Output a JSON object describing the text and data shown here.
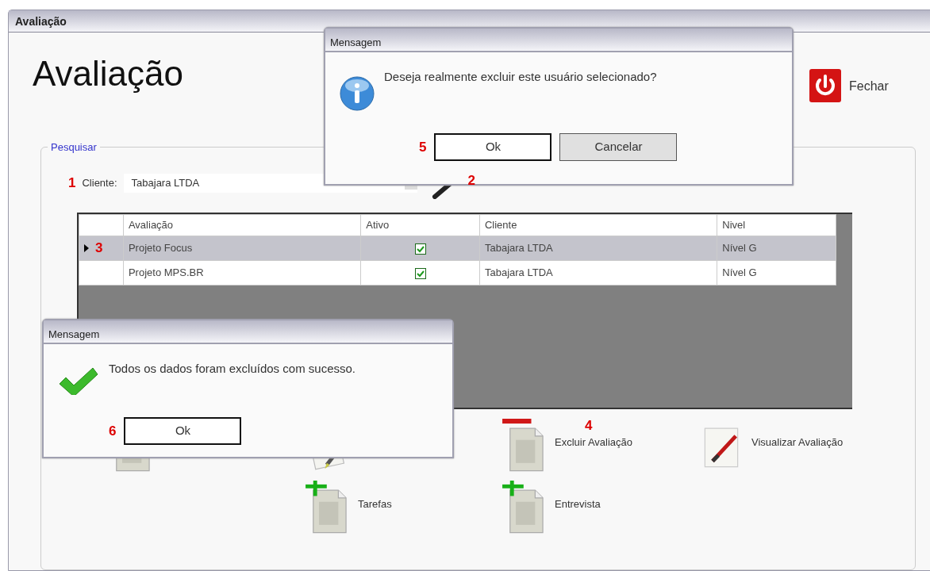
{
  "window": {
    "title": "Avaliação"
  },
  "heading": "Avaliação",
  "close_button": {
    "label": "Fechar"
  },
  "search_group": {
    "title": "Pesquisar",
    "client_callout": "1",
    "client_label": "Cliente:",
    "client_value": "Tabajara LTDA",
    "search_callout": "2"
  },
  "grid": {
    "columns": [
      "Avaliação",
      "Ativo",
      "Cliente",
      "Nivel"
    ],
    "rows": [
      {
        "selected": true,
        "callout": "3",
        "avaliacao": "Projeto Focus",
        "ativo": true,
        "cliente": "Tabajara LTDA",
        "nivel": "Nível G"
      },
      {
        "selected": false,
        "avaliacao": "Projeto MPS.BR",
        "ativo": true,
        "cliente": "Tabajara LTDA",
        "nivel": "Nível G"
      }
    ]
  },
  "actions": [
    {
      "kind": "document"
    },
    {
      "kind": "edit"
    },
    {
      "kind": "delete",
      "label": "Excluir Avaliação",
      "callout": "4"
    },
    {
      "kind": "view",
      "label": "Visualizar Avaliação"
    },
    {
      "kind": "add",
      "label": "Tarefas"
    },
    {
      "kind": "add",
      "label": "Entrevista"
    }
  ],
  "dialogs": [
    {
      "kind": "info",
      "title": "Mensagem",
      "message": "Deseja realmente excluir este usuário selecionado?",
      "callout": "5",
      "buttons": [
        {
          "label": "Ok",
          "focused": true
        },
        {
          "label": "Cancelar",
          "focused": false
        }
      ]
    },
    {
      "kind": "success",
      "title": "Mensagem",
      "message": "Todos os dados foram excluídos com sucesso.",
      "callout": "6",
      "buttons": [
        {
          "label": "Ok",
          "focused": true
        }
      ]
    }
  ]
}
